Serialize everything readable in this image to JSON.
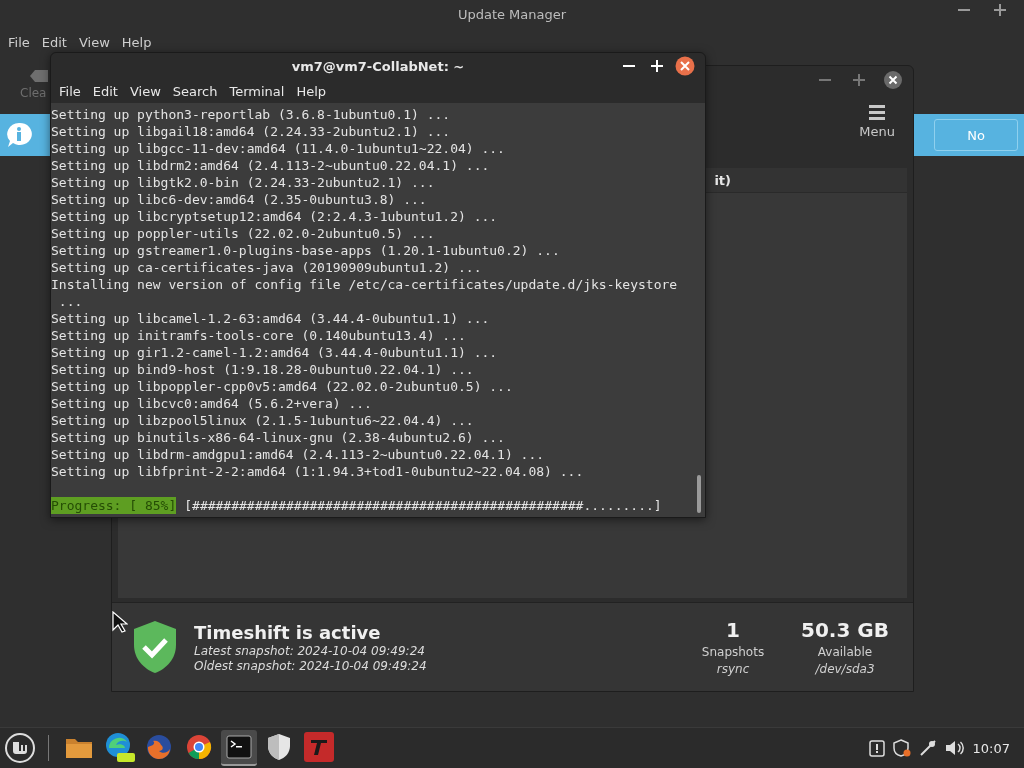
{
  "update_manager": {
    "title": "Update Manager",
    "menu": [
      "File",
      "Edit",
      "View",
      "Help"
    ],
    "toolbar_label": "Clea",
    "info_button": "No"
  },
  "timeshift_window": {
    "menu_button": "Menu",
    "column_header": "it)",
    "status": {
      "title": "Timeshift is active",
      "latest": "Latest snapshot: 2024-10-04 09:49:24",
      "oldest": "Oldest snapshot: 2024-10-04 09:49:24",
      "stats": [
        {
          "value": "1",
          "label": "Snapshots",
          "detail": "rsync"
        },
        {
          "value": "50.3 GB",
          "label": "Available",
          "detail": "/dev/sda3"
        }
      ]
    }
  },
  "terminal": {
    "title": "vm7@vm7-CollabNet: ~",
    "menu": [
      "File",
      "Edit",
      "View",
      "Search",
      "Terminal",
      "Help"
    ],
    "lines": [
      "Setting up python3-reportlab (3.6.8-1ubuntu0.1) ...",
      "Setting up libgail18:amd64 (2.24.33-2ubuntu2.1) ...",
      "Setting up libgcc-11-dev:amd64 (11.4.0-1ubuntu1~22.04) ...",
      "Setting up libdrm2:amd64 (2.4.113-2~ubuntu0.22.04.1) ...",
      "Setting up libgtk2.0-bin (2.24.33-2ubuntu2.1) ...",
      "Setting up libc6-dev:amd64 (2.35-0ubuntu3.8) ...",
      "Setting up libcryptsetup12:amd64 (2:2.4.3-1ubuntu1.2) ...",
      "Setting up poppler-utils (22.02.0-2ubuntu0.5) ...",
      "Setting up gstreamer1.0-plugins-base-apps (1.20.1-1ubuntu0.2) ...",
      "Setting up ca-certificates-java (20190909ubuntu1.2) ...",
      "Installing new version of config file /etc/ca-certificates/update.d/jks-keystore",
      " ...",
      "Setting up libcamel-1.2-63:amd64 (3.44.4-0ubuntu1.1) ...",
      "Setting up initramfs-tools-core (0.140ubuntu13.4) ...",
      "Setting up gir1.2-camel-1.2:amd64 (3.44.4-0ubuntu1.1) ...",
      "Setting up bind9-host (1:9.18.28-0ubuntu0.22.04.1) ...",
      "Setting up libpoppler-cpp0v5:amd64 (22.02.0-2ubuntu0.5) ...",
      "Setting up libcvc0:amd64 (5.6.2+vera) ...",
      "Setting up libzpool5linux (2.1.5-1ubuntu6~22.04.4) ...",
      "Setting up binutils-x86-64-linux-gnu (2.38-4ubuntu2.6) ...",
      "Setting up libdrm-amdgpu1:amd64 (2.4.113-2~ubuntu0.22.04.1) ...",
      "Setting up libfprint-2-2:amd64 (1:1.94.3+tod1-0ubuntu2~22.04.08) ..."
    ],
    "progress_label": "Progress: [ 85%]",
    "progress_bar": "[##################################################.........]"
  },
  "taskbar": {
    "apps": [
      {
        "kind": "files",
        "selected": false
      },
      {
        "kind": "edge",
        "selected": false
      },
      {
        "kind": "firefox",
        "selected": false
      },
      {
        "kind": "chrome",
        "selected": false
      },
      {
        "kind": "terminal",
        "selected": true
      },
      {
        "kind": "shield",
        "selected": false
      },
      {
        "kind": "typo",
        "selected": false
      }
    ],
    "clock": "10:07"
  }
}
